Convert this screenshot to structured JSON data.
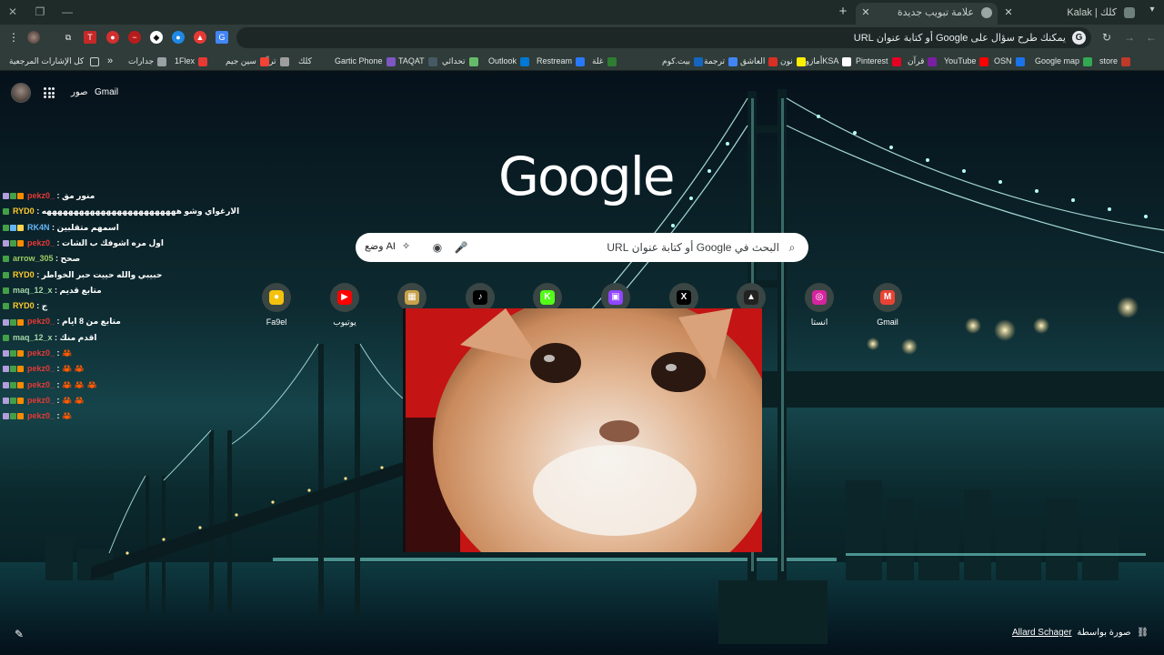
{
  "window": {
    "tabs": [
      {
        "title": "Kalak | كلك",
        "active": false
      },
      {
        "title": "علامة تبويب جديدة",
        "active": true
      }
    ],
    "new_tab": "+",
    "controls": [
      "close",
      "restore",
      "minimize"
    ]
  },
  "toolbar": {
    "omnibox_placeholder": "يمكنك طرح سؤال على Google أو كتابة عنوان URL",
    "g_badge": "G"
  },
  "bookmarks": {
    "items": [
      {
        "label": "store",
        "color": "#c0392b"
      },
      {
        "label": "Google map",
        "color": "#34a853"
      },
      {
        "label": "OSN",
        "color": "#1a73e8"
      },
      {
        "label": "YouTube",
        "color": "#ff0000"
      },
      {
        "label": "قرآن",
        "color": "#7b1fa2"
      },
      {
        "label": "Pinterest",
        "color": "#e60023"
      },
      {
        "label": "أمازونKSA",
        "color": "#ffffff"
      },
      {
        "label": "نون",
        "color": "#feee00"
      },
      {
        "label": "العاشق",
        "color": "#d93025"
      },
      {
        "label": "ترجمة",
        "color": "#4285f4"
      },
      {
        "label": "بيت.كوم",
        "color": "#1565c0"
      },
      {
        "label": "غلة",
        "color": "#2e7d32"
      },
      {
        "label": "Restream",
        "color": "#2979ff"
      },
      {
        "label": "Outlook",
        "color": "#0078d4"
      },
      {
        "label": "تحدائي",
        "color": "#66bb6a"
      },
      {
        "label": "TAQAT",
        "color": "#455a64"
      },
      {
        "label": "Gartic Phone",
        "color": "#7e57c2"
      },
      {
        "label": "كلك",
        "color": "#2f3c39"
      },
      {
        "label": "ترفّع",
        "color": "#9e9e9e"
      },
      {
        "label": "سين جيم",
        "color": "#f44336"
      },
      {
        "label": "1Flex",
        "color": "#e53935"
      },
      {
        "label": "جدارات",
        "color": "#9aa0a6"
      }
    ],
    "overflow": "»",
    "all_bookmarks": "كل الإشارات المرجعية"
  },
  "ntp": {
    "gmail": "Gmail",
    "images": "صور",
    "logo": "Google",
    "search_placeholder": "البحث في Google أو كتابة عنوان URL",
    "ai_mode": "وضع AI",
    "shortcuts": [
      {
        "label": "Gmail",
        "icon": "gmail-icon",
        "color": "#ea4335",
        "glyph": "M"
      },
      {
        "label": "انستا",
        "icon": "instagram-icon",
        "color": "#d6249f",
        "glyph": "◎"
      },
      {
        "label": "",
        "icon": "overflow-shortcut-icon",
        "color": "#222222",
        "glyph": "▲"
      },
      {
        "label": "",
        "icon": "x-icon",
        "color": "#000000",
        "glyph": "X"
      },
      {
        "label": "",
        "icon": "twitch-icon",
        "color": "#9146ff",
        "glyph": "▣"
      },
      {
        "label": "",
        "icon": "kick-icon",
        "color": "#53fc18",
        "glyph": "K"
      },
      {
        "label": "",
        "icon": "tiktok-icon",
        "color": "#000000",
        "glyph": "♪"
      },
      {
        "label": "",
        "icon": "gift-box-icon",
        "color": "#c8a24a",
        "glyph": "▦"
      },
      {
        "label": "يوتيوب",
        "icon": "youtube-icon",
        "color": "#ff0000",
        "glyph": "▶"
      },
      {
        "label": "Fa9el",
        "icon": "fa9el-icon",
        "color": "#f4c20d",
        "glyph": "●"
      }
    ],
    "credit_prefix": "صورة بواسطة",
    "credit_author": "Allard Schager"
  },
  "chat": {
    "lines": [
      {
        "user": "pekz0_",
        "user_color": "#e53935",
        "msg": "منور مق",
        "badges": [
          "#b39ddb",
          "#43a047",
          "#fb8c00"
        ]
      },
      {
        "user": "RYD0",
        "user_color": "#ffca28",
        "msg": "الارغواي وشو هههههههههههههههههههههههههه",
        "badges": [
          "#43a047"
        ]
      },
      {
        "user": "RK4N",
        "user_color": "#64b5f6",
        "msg": "اسمهم متقلبين",
        "badges": [
          "#43a047",
          "#64b5f6",
          "#ffd54f"
        ]
      },
      {
        "user": "pekz0_",
        "user_color": "#e53935",
        "msg": "اول مره اشوفك ب الشات",
        "badges": [
          "#b39ddb",
          "#43a047",
          "#fb8c00"
        ]
      },
      {
        "user": "arrow_305",
        "user_color": "#9ccc65",
        "msg": "صحح",
        "badges": [
          "#43a047"
        ]
      },
      {
        "user": "RYD0",
        "user_color": "#ffca28",
        "msg": "حبيبي والله حييت حبر الخواطر",
        "badges": [
          "#43a047"
        ]
      },
      {
        "user": "maq_12_x",
        "user_color": "#a5d6a7",
        "msg": "متابع قديم",
        "badges": [
          "#43a047"
        ]
      },
      {
        "user": "RYD0",
        "user_color": "#ffca28",
        "msg": "ج",
        "badges": [
          "#43a047"
        ]
      },
      {
        "user": "pekz0_",
        "user_color": "#e53935",
        "msg": "متابع من 8 ايام",
        "badges": [
          "#b39ddb",
          "#43a047",
          "#fb8c00"
        ]
      },
      {
        "user": "maq_12_x",
        "user_color": "#a5d6a7",
        "msg": "اقدم منك",
        "badges": [
          "#43a047"
        ]
      },
      {
        "user": "pekz0_",
        "user_color": "#e53935",
        "msg": "🦀",
        "badges": [
          "#b39ddb",
          "#43a047",
          "#fb8c00"
        ]
      },
      {
        "user": "pekz0_",
        "user_color": "#e53935",
        "msg": "🦀 🦀",
        "badges": [
          "#b39ddb",
          "#43a047",
          "#fb8c00"
        ]
      },
      {
        "user": "pekz0_",
        "user_color": "#e53935",
        "msg": "🦀 🦀 🦀",
        "badges": [
          "#b39ddb",
          "#43a047",
          "#fb8c00"
        ]
      },
      {
        "user": "pekz0_",
        "user_color": "#e53935",
        "msg": "🦀 🦀",
        "badges": [
          "#b39ddb",
          "#43a047",
          "#fb8c00"
        ]
      },
      {
        "user": "pekz0_",
        "user_color": "#e53935",
        "msg": "🦀",
        "badges": [
          "#b39ddb",
          "#43a047",
          "#fb8c00"
        ]
      }
    ]
  }
}
